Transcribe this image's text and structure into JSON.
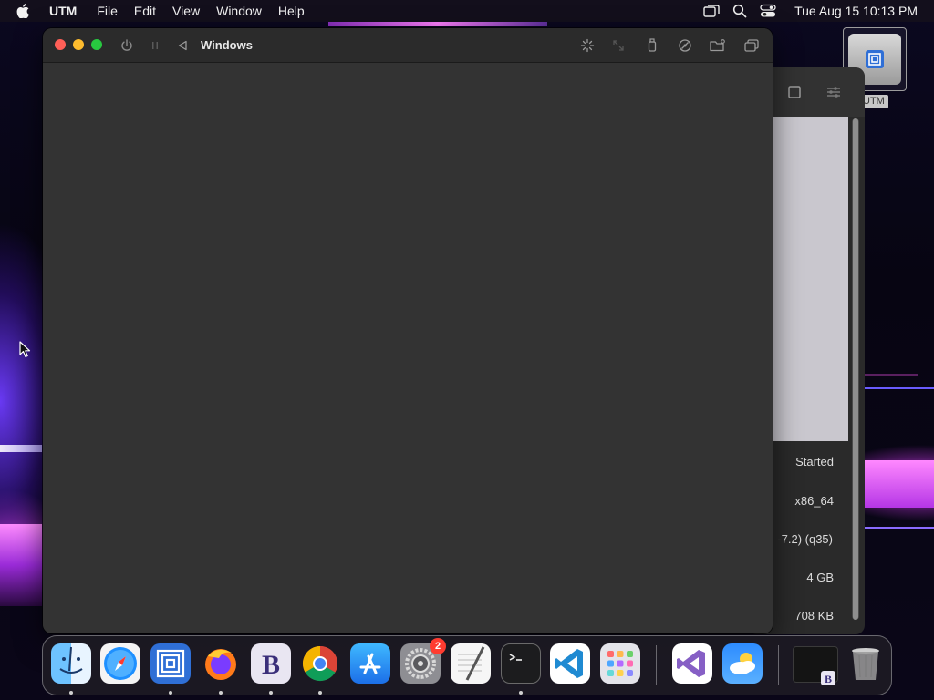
{
  "menubar": {
    "app_name": "UTM",
    "menus": [
      "File",
      "Edit",
      "View",
      "Window",
      "Help"
    ],
    "clock": "Tue Aug 15  10:13 PM"
  },
  "desktop": {
    "drive_label": "UTM"
  },
  "vm_window": {
    "title": "Windows",
    "toolbar_icons": [
      "power-icon",
      "pause-icon",
      "back-icon",
      "display-icon",
      "resize-icon",
      "usb-icon",
      "drive-icon",
      "shared-folder-icon",
      "windows-icon"
    ]
  },
  "library_window": {
    "info_values": [
      "Started",
      "x86_64",
      "-7.2) (q35)",
      "4 GB",
      "708 KB"
    ]
  },
  "dock": {
    "apps": [
      {
        "name": "Finder",
        "running": true
      },
      {
        "name": "Safari",
        "running": false
      },
      {
        "name": "UTM",
        "running": true
      },
      {
        "name": "Firefox",
        "running": true
      },
      {
        "name": "BBEdit",
        "running": true
      },
      {
        "name": "Chrome",
        "running": true
      },
      {
        "name": "App Store",
        "running": false
      },
      {
        "name": "System Settings",
        "running": false,
        "badge": "2"
      },
      {
        "name": "TextEdit",
        "running": false
      },
      {
        "name": "Terminal",
        "running": true
      },
      {
        "name": "VS Code",
        "running": false
      },
      {
        "name": "Launchpad",
        "running": false
      },
      {
        "name": "Visual Studio",
        "running": false
      },
      {
        "name": "Weather",
        "running": false
      },
      {
        "name": "Minimized Window",
        "running": false
      },
      {
        "name": "Trash",
        "running": false
      }
    ]
  },
  "colors": {
    "window_bg": "#333333",
    "titlebar_bg": "#2b2b2b",
    "close": "#ff5f57",
    "minimize": "#febc2e",
    "maximize": "#28c840",
    "badge": "#ff3b30"
  }
}
